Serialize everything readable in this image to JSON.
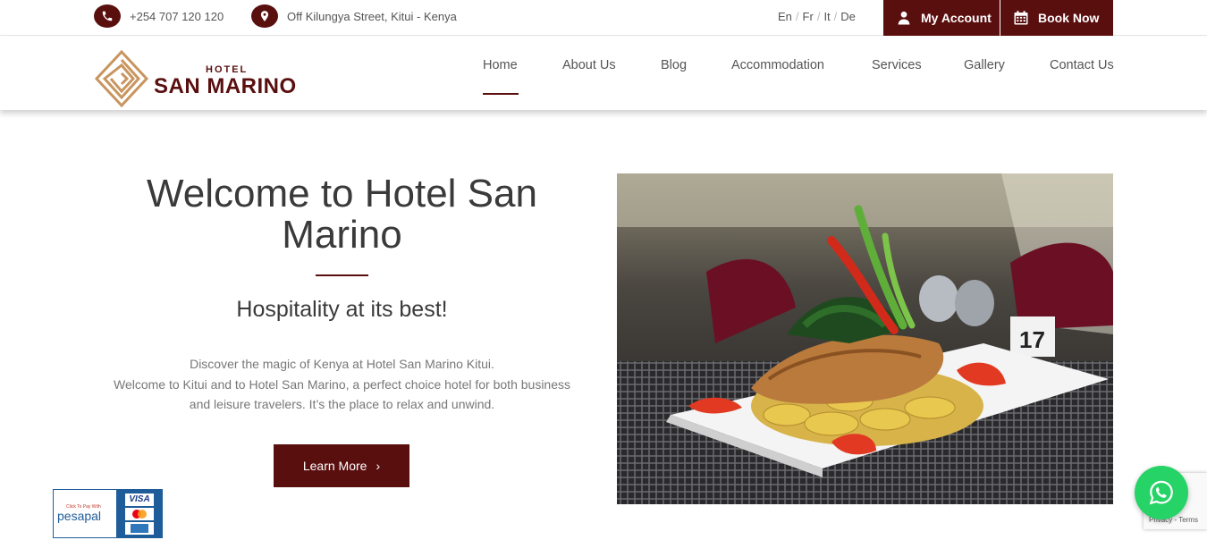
{
  "topbar": {
    "phone": "+254 707 120 120",
    "address": "Off Kilungya Street, Kitui - Kenya",
    "languages": [
      "En",
      "Fr",
      "It",
      "De"
    ],
    "account_label": "My Account",
    "book_label": "Book Now"
  },
  "logo": {
    "small": "HOTEL",
    "name": "SAN MARINO"
  },
  "nav": {
    "items": [
      "Home",
      "About Us",
      "Blog",
      "Accommodation",
      "Services",
      "Gallery",
      "Contact Us"
    ],
    "active": "Home"
  },
  "hero": {
    "title_line1": "Welcome to Hotel San",
    "title_line2": "Marino",
    "subtitle": "Hospitality at its best!",
    "text_line1": "Discover the magic of Kenya at Hotel San Marino Kitui.",
    "text_line2": "Welcome to Kitui and to Hotel San Marino, a perfect choice hotel for both business",
    "text_line3": "and leisure travelers. It’s the place to relax and unwind.",
    "button_label": "Learn More"
  },
  "payment": {
    "small": "Click To Pay With",
    "brand": "pesapal",
    "card": "VISA"
  },
  "recaptcha": {
    "text": "Privacy - Terms"
  },
  "colors": {
    "brand": "#5a0f0f",
    "whatsapp": "#25d366",
    "logo_gold": "#c8955f"
  },
  "icons": [
    "phone-icon",
    "location-pin-icon",
    "user-icon",
    "calendar-icon",
    "chevron-right-icon",
    "whatsapp-icon"
  ]
}
